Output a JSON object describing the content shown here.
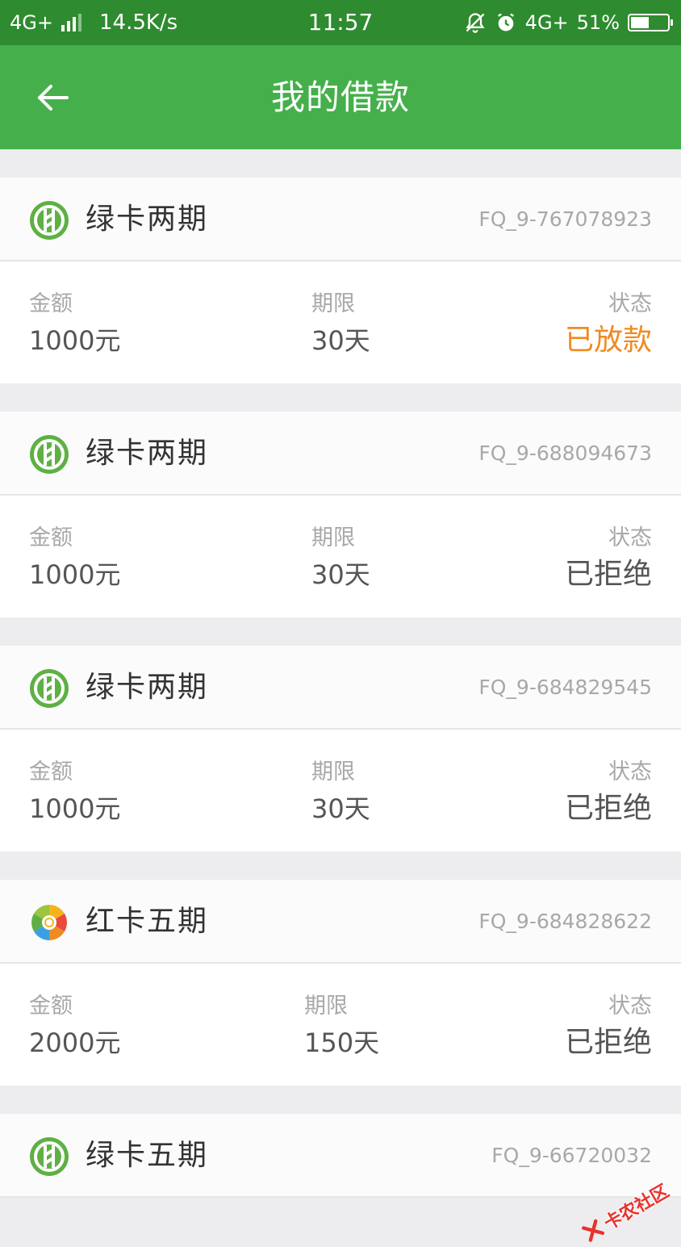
{
  "status_bar": {
    "network": "4G+",
    "speed": "14.5K/s",
    "time": "11:57",
    "network_right": "4G+",
    "battery": "51%",
    "battery_level": 0.51
  },
  "header": {
    "title": "我的借款",
    "background": "#45b04b"
  },
  "colors": {
    "approved": "#f08a22",
    "green_logo": "#5fb044"
  },
  "loans": [
    {
      "product": "绿卡两期",
      "logo": "green-card-logo",
      "order_no": "FQ_9-767078923",
      "amount_label": "金额",
      "amount": "1000元",
      "term_label": "期限",
      "term": "30天",
      "status_label": "状态",
      "status": "已放款",
      "status_type": "approved"
    },
    {
      "product": "绿卡两期",
      "logo": "green-card-logo",
      "order_no": "FQ_9-688094673",
      "amount_label": "金额",
      "amount": "1000元",
      "term_label": "期限",
      "term": "30天",
      "status_label": "状态",
      "status": "已拒绝",
      "status_type": "rejected"
    },
    {
      "product": "绿卡两期",
      "logo": "green-card-logo",
      "order_no": "FQ_9-684829545",
      "amount_label": "金额",
      "amount": "1000元",
      "term_label": "期限",
      "term": "30天",
      "status_label": "状态",
      "status": "已拒绝",
      "status_type": "rejected"
    },
    {
      "product": "红卡五期",
      "logo": "red-card-logo",
      "order_no": "FQ_9-684828622",
      "amount_label": "金额",
      "amount": "2000元",
      "term_label": "期限",
      "term": "150天",
      "status_label": "状态",
      "status": "已拒绝",
      "status_type": "rejected"
    },
    {
      "product": "绿卡五期",
      "logo": "green-card-logo",
      "order_no": "FQ_9-66720032"
    }
  ],
  "watermark": "卡农社区"
}
